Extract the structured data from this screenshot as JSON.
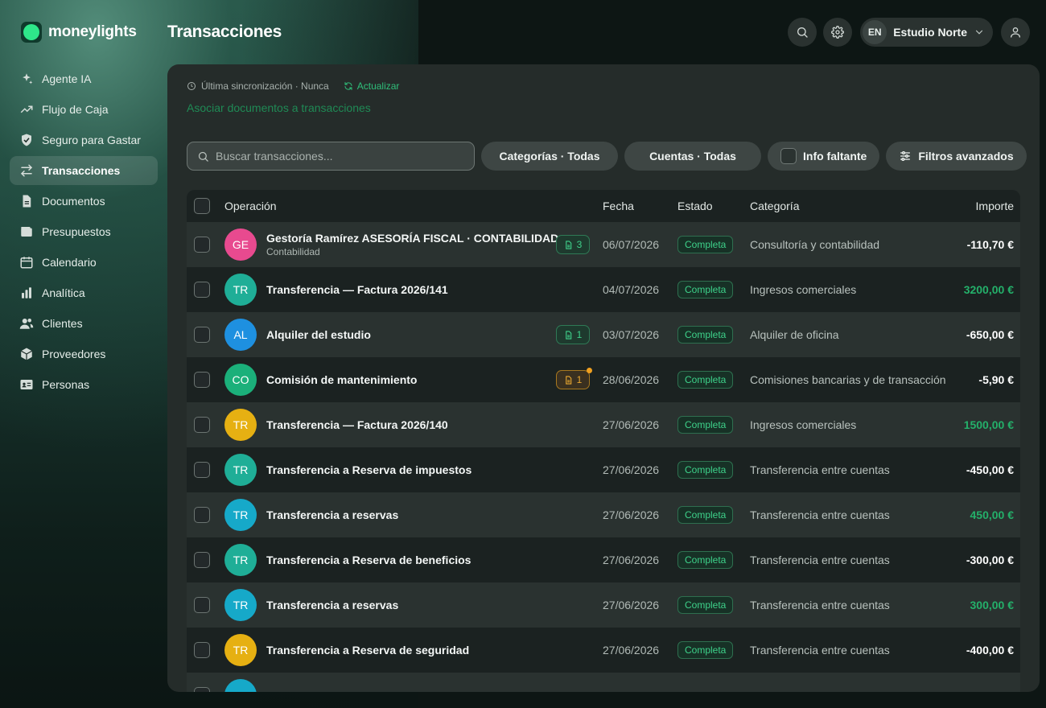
{
  "app": {
    "name": "moneylights"
  },
  "header": {
    "title": "Transacciones",
    "org_initials": "EN",
    "org_name": "Estudio Norte"
  },
  "sidebar": {
    "items": [
      {
        "label": "Agente IA",
        "icon": "sparkles-icon",
        "active": false
      },
      {
        "label": "Flujo de Caja",
        "icon": "trend-up-icon",
        "active": false
      },
      {
        "label": "Seguro para Gastar",
        "icon": "shield-check-icon",
        "active": false
      },
      {
        "label": "Transacciones",
        "icon": "arrows-swap-icon",
        "active": true
      },
      {
        "label": "Documentos",
        "icon": "document-icon",
        "active": false
      },
      {
        "label": "Presupuestos",
        "icon": "wallet-icon",
        "active": false
      },
      {
        "label": "Calendario",
        "icon": "calendar-icon",
        "active": false
      },
      {
        "label": "Analítica",
        "icon": "bar-chart-icon",
        "active": false
      },
      {
        "label": "Clientes",
        "icon": "users-icon",
        "active": false
      },
      {
        "label": "Proveedores",
        "icon": "box-icon",
        "active": false
      },
      {
        "label": "Personas",
        "icon": "id-card-icon",
        "active": false
      }
    ]
  },
  "main": {
    "sync_text": "Última sincronización · Nunca",
    "refresh_label": "Actualizar",
    "assoc_link": "Asociar documentos a transacciones",
    "search_placeholder": "Buscar transacciones...",
    "filter_categories": "Categorías · Todas",
    "filter_accounts": "Cuentas · Todas",
    "filter_missing": "Info faltante",
    "filter_advanced": "Filtros avanzados"
  },
  "table": {
    "headers": {
      "operation": "Operación",
      "date": "Fecha",
      "status": "Estado",
      "category": "Categoría",
      "amount": "Importe"
    },
    "rows": [
      {
        "initials": "GE",
        "color": "#e84a8f",
        "name": "Gestoría Ramírez ASESORÍA FISCAL · CONTABILIDAD",
        "sub": "Contabilidad",
        "docs": "3",
        "doc_warn": false,
        "date": "06/07/2026",
        "status": "Completa",
        "category": "Consultoría y contabilidad",
        "amount": "-110,70 €",
        "positive": false
      },
      {
        "initials": "TR",
        "color": "#1fae97",
        "name": "Transferencia — Factura 2026/141",
        "sub": "",
        "docs": "",
        "doc_warn": false,
        "date": "04/07/2026",
        "status": "Completa",
        "category": "Ingresos comerciales",
        "amount": "3200,00 €",
        "positive": true
      },
      {
        "initials": "AL",
        "color": "#1e90e0",
        "name": "Alquiler del estudio",
        "sub": "",
        "docs": "1",
        "doc_warn": false,
        "date": "03/07/2026",
        "status": "Completa",
        "category": "Alquiler de oficina",
        "amount": "-650,00 €",
        "positive": false
      },
      {
        "initials": "CO",
        "color": "#1bb07a",
        "name": "Comisión de mantenimiento",
        "sub": "",
        "docs": "1",
        "doc_warn": true,
        "date": "28/06/2026",
        "status": "Completa",
        "category": "Comisiones bancarias y de transacción",
        "amount": "-5,90 €",
        "positive": false
      },
      {
        "initials": "TR",
        "color": "#e6b012",
        "name": "Transferencia — Factura 2026/140",
        "sub": "",
        "docs": "",
        "doc_warn": false,
        "date": "27/06/2026",
        "status": "Completa",
        "category": "Ingresos comerciales",
        "amount": "1500,00 €",
        "positive": true
      },
      {
        "initials": "TR",
        "color": "#1fae97",
        "name": "Transferencia a Reserva de impuestos",
        "sub": "",
        "docs": "",
        "doc_warn": false,
        "date": "27/06/2026",
        "status": "Completa",
        "category": "Transferencia entre cuentas",
        "amount": "-450,00 €",
        "positive": false
      },
      {
        "initials": "TR",
        "color": "#16a9c9",
        "name": "Transferencia a reservas",
        "sub": "",
        "docs": "",
        "doc_warn": false,
        "date": "27/06/2026",
        "status": "Completa",
        "category": "Transferencia entre cuentas",
        "amount": "450,00 €",
        "positive": true
      },
      {
        "initials": "TR",
        "color": "#1fae97",
        "name": "Transferencia a Reserva de beneficios",
        "sub": "",
        "docs": "",
        "doc_warn": false,
        "date": "27/06/2026",
        "status": "Completa",
        "category": "Transferencia entre cuentas",
        "amount": "-300,00 €",
        "positive": false
      },
      {
        "initials": "TR",
        "color": "#16a9c9",
        "name": "Transferencia a reservas",
        "sub": "",
        "docs": "",
        "doc_warn": false,
        "date": "27/06/2026",
        "status": "Completa",
        "category": "Transferencia entre cuentas",
        "amount": "300,00 €",
        "positive": true
      },
      {
        "initials": "TR",
        "color": "#e6b012",
        "name": "Transferencia a Reserva de seguridad",
        "sub": "",
        "docs": "",
        "doc_warn": false,
        "date": "27/06/2026",
        "status": "Completa",
        "category": "Transferencia entre cuentas",
        "amount": "-400,00 €",
        "positive": false
      }
    ]
  }
}
